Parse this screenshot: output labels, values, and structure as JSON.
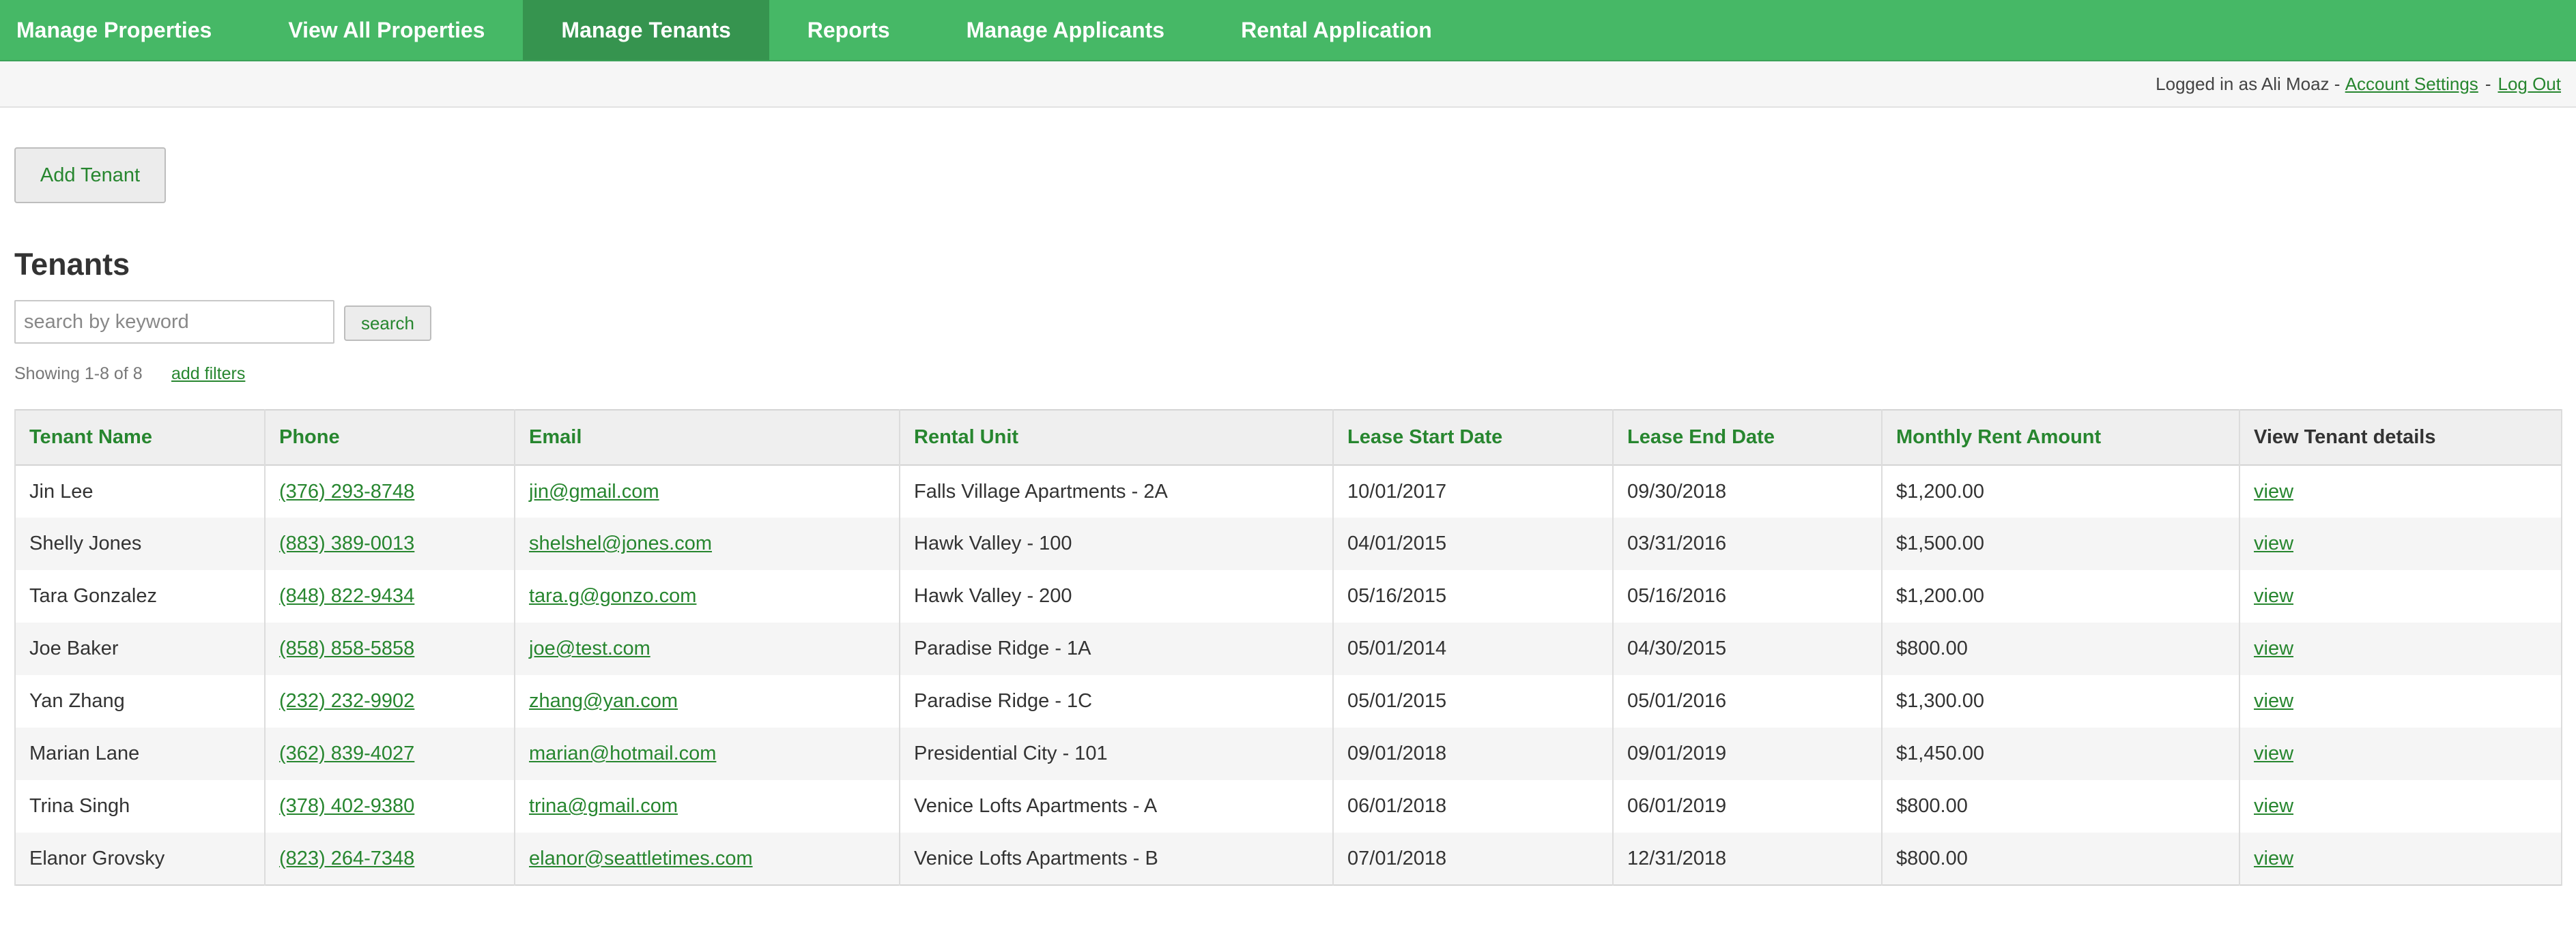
{
  "nav": {
    "items": [
      {
        "label": "Manage Properties"
      },
      {
        "label": "View All Properties"
      },
      {
        "label": "Manage Tenants"
      },
      {
        "label": "Reports"
      },
      {
        "label": "Manage Applicants"
      },
      {
        "label": "Rental Application"
      }
    ],
    "active_index": 2
  },
  "status": {
    "logged_in": "Logged in as Ali Moaz -",
    "account_settings": "Account Settings",
    "separator": "-",
    "logout": "Log Out"
  },
  "actions": {
    "add_tenant": "Add Tenant"
  },
  "page": {
    "title": "Tenants"
  },
  "search": {
    "placeholder": "search by keyword",
    "value": "",
    "button": "search"
  },
  "results": {
    "showing": "Showing 1-8 of 8",
    "add_filters": "add filters"
  },
  "table": {
    "headers": [
      "Tenant Name",
      "Phone",
      "Email",
      "Rental Unit",
      "Lease Start Date",
      "Lease End Date",
      "Monthly Rent Amount",
      "View Tenant details"
    ],
    "rows": [
      {
        "name": "Jin Lee",
        "phone": "(376) 293-8748",
        "email": "jin@gmail.com",
        "unit": "Falls Village Apartments - 2A",
        "start": "10/01/2017",
        "end": "09/30/2018",
        "rent": "$1,200.00",
        "view": "view"
      },
      {
        "name": "Shelly Jones",
        "phone": "(883) 389-0013",
        "email": "shelshel@jones.com",
        "unit": "Hawk Valley - 100",
        "start": "04/01/2015",
        "end": "03/31/2016",
        "rent": "$1,500.00",
        "view": "view"
      },
      {
        "name": "Tara Gonzalez",
        "phone": "(848) 822-9434",
        "email": "tara.g@gonzo.com",
        "unit": "Hawk Valley - 200",
        "start": "05/16/2015",
        "end": "05/16/2016",
        "rent": "$1,200.00",
        "view": "view"
      },
      {
        "name": "Joe Baker",
        "phone": "(858) 858-5858",
        "email": "joe@test.com",
        "unit": "Paradise Ridge - 1A",
        "start": "05/01/2014",
        "end": "04/30/2015",
        "rent": "$800.00",
        "view": "view"
      },
      {
        "name": "Yan Zhang",
        "phone": "(232) 232-9902",
        "email": "zhang@yan.com",
        "unit": "Paradise Ridge - 1C",
        "start": "05/01/2015",
        "end": "05/01/2016",
        "rent": "$1,300.00",
        "view": "view"
      },
      {
        "name": "Marian Lane",
        "phone": "(362) 839-4027",
        "email": "marian@hotmail.com",
        "unit": "Presidential City - 101",
        "start": "09/01/2018",
        "end": "09/01/2019",
        "rent": "$1,450.00",
        "view": "view"
      },
      {
        "name": "Trina Singh",
        "phone": "(378) 402-9380",
        "email": "trina@gmail.com",
        "unit": "Venice Lofts Apartments - A",
        "start": "06/01/2018",
        "end": "06/01/2019",
        "rent": "$800.00",
        "view": "view"
      },
      {
        "name": "Elanor Grovsky",
        "phone": "(823) 264-7348",
        "email": "elanor@seattletimes.com",
        "unit": "Venice Lofts Apartments - B",
        "start": "07/01/2018",
        "end": "12/31/2018",
        "rent": "$800.00",
        "view": "view"
      }
    ]
  },
  "colors": {
    "nav_bg": "#46b866",
    "nav_active": "#36944f",
    "link": "#27862f"
  }
}
